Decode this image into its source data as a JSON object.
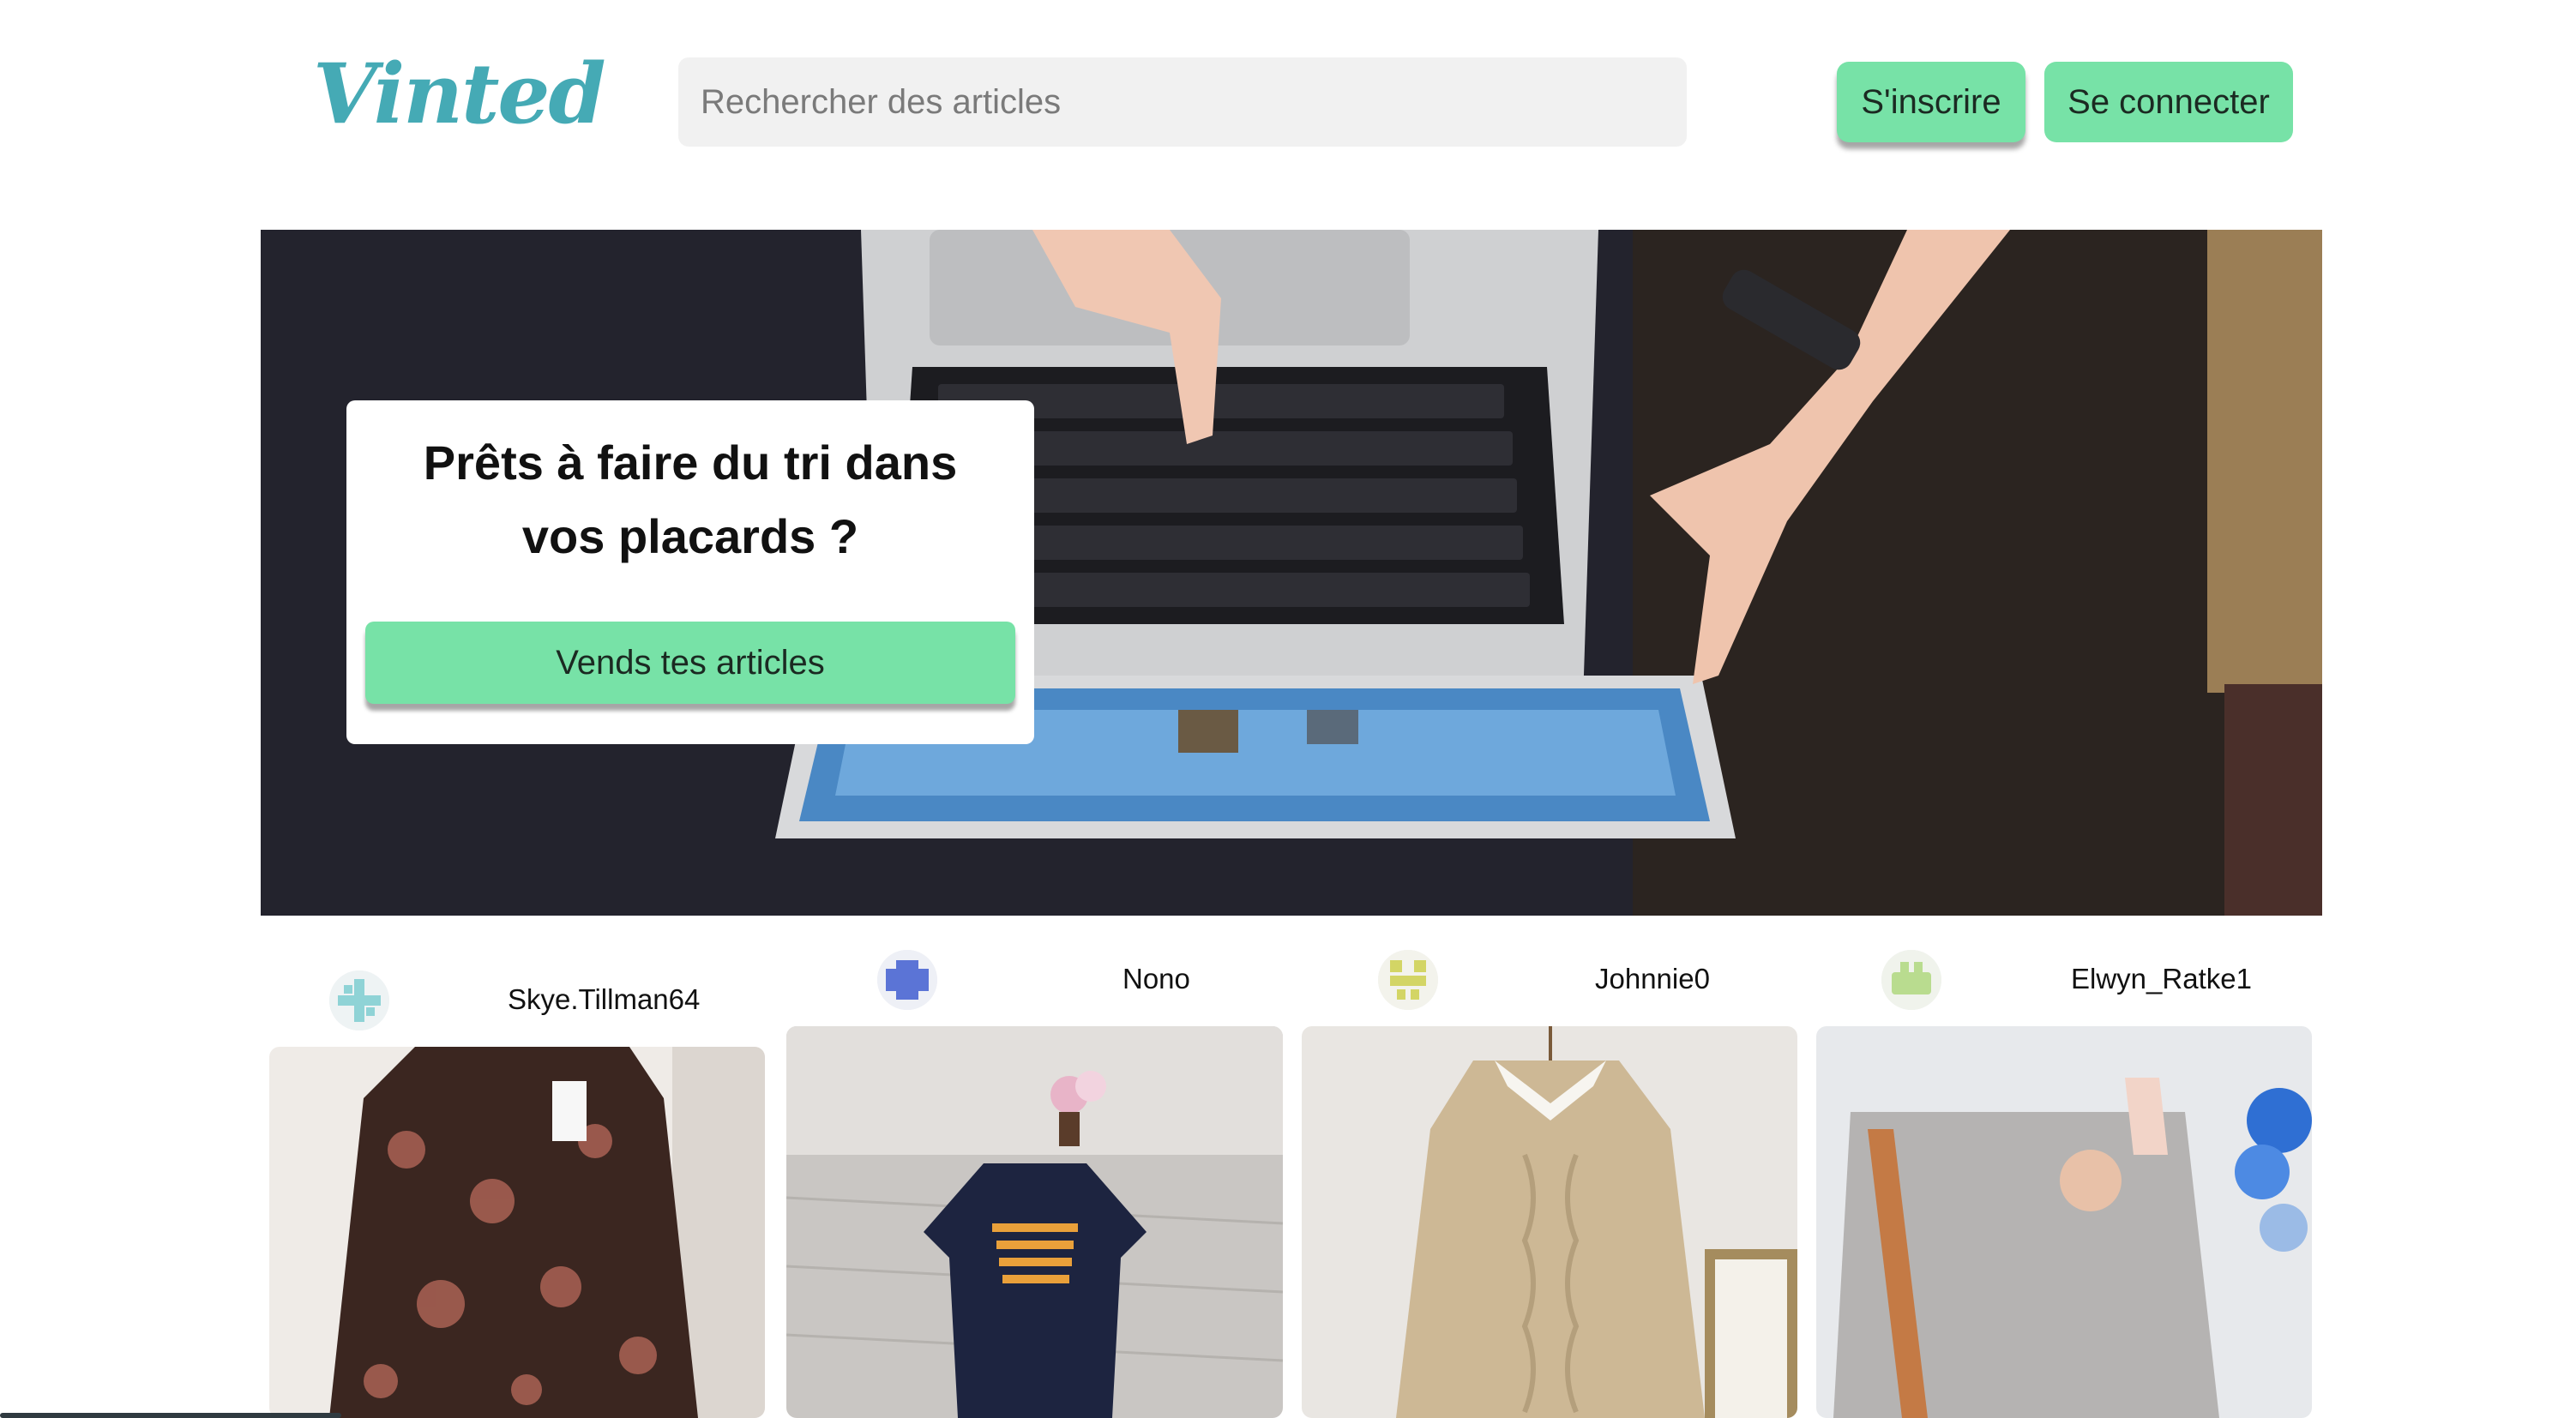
{
  "colors": {
    "brand": "#45aab5",
    "accent_green": "#77e2a7",
    "search_bg": "#f1f1f1"
  },
  "header": {
    "logo_text": "Vinted",
    "search_placeholder": "Rechercher des articles",
    "signup_label": "S'inscrire",
    "login_label": "Se connecter"
  },
  "hero": {
    "title": "Prêts à faire du tri dans vos placards ?",
    "cta_label": "Vends tes articles"
  },
  "listings": [
    {
      "seller": "Skye.Tillman64",
      "avatar_icon": "identicon-teal-cross-icon"
    },
    {
      "seller": "Nono",
      "avatar_icon": "identicon-blue-blocks-icon"
    },
    {
      "seller": "Johnnie0",
      "avatar_icon": "identicon-yellow-blocks-icon"
    },
    {
      "seller": "Elwyn_Ratke1",
      "avatar_icon": "identicon-green-blocks-icon"
    }
  ]
}
